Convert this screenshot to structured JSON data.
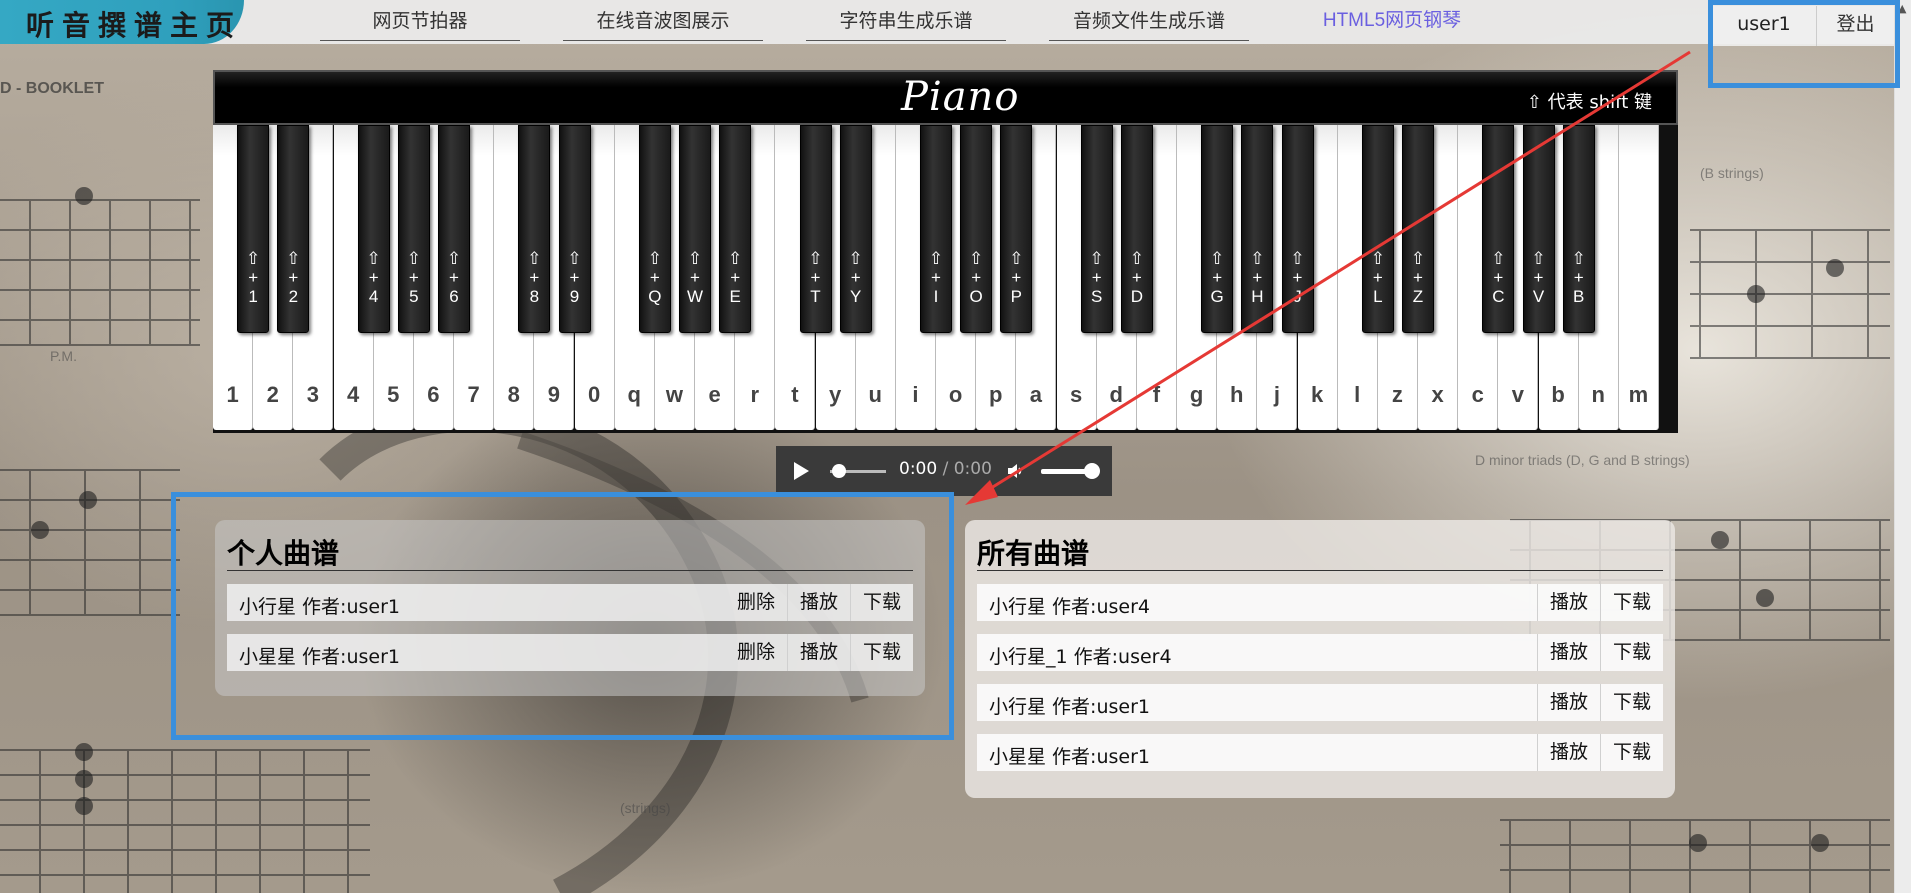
{
  "nav": {
    "logo": "听音撰谱主页",
    "links": [
      "网页节拍器",
      "在线音波图展示",
      "字符串生成乐谱",
      "音频文件生成乐谱",
      "HTML5网页钢琴"
    ],
    "user": "user1",
    "logout": "登出"
  },
  "background": {
    "booklet_text": "D - BOOKLET",
    "label_pm": "P.M.",
    "label_strings": "(strings)",
    "label_b_strings": "(B strings)",
    "label_triads": "D minor triads (D, G and B strings)"
  },
  "piano": {
    "logo": "Piano",
    "shift_note": "⇧ 代表 shift 键",
    "white_keys": [
      "1",
      "2",
      "3",
      "4",
      "5",
      "6",
      "7",
      "8",
      "9",
      "0",
      "q",
      "w",
      "e",
      "r",
      "t",
      "y",
      "u",
      "i",
      "o",
      "p",
      "a",
      "s",
      "d",
      "f",
      "g",
      "h",
      "j",
      "k",
      "l",
      "z",
      "x",
      "c",
      "v",
      "b",
      "n",
      "m"
    ],
    "black_keys": [
      "1",
      "2",
      "4",
      "5",
      "6",
      "8",
      "9",
      "Q",
      "W",
      "E",
      "T",
      "Y",
      "I",
      "O",
      "P",
      "S",
      "D",
      "G",
      "H",
      "J",
      "L",
      "Z",
      "C",
      "V",
      "B"
    ],
    "shift_symbol": "⇧",
    "plus_symbol": "+"
  },
  "player": {
    "current": "0:00",
    "separator": " / ",
    "duration": "0:00"
  },
  "personal": {
    "title": "个人曲谱",
    "rows": [
      {
        "title": "小行星 作者:user1"
      },
      {
        "title": "小星星 作者:user1"
      }
    ],
    "btn_delete": "删除",
    "btn_play": "播放",
    "btn_download": "下载"
  },
  "all": {
    "title": "所有曲谱",
    "rows": [
      {
        "title": "小行星 作者:user4"
      },
      {
        "title": "小行星_1 作者:user4"
      },
      {
        "title": "小行星 作者:user1"
      },
      {
        "title": "小星星 作者:user1"
      }
    ],
    "btn_play": "播放",
    "btn_download": "下载"
  },
  "colors": {
    "annotation": "#3a8fdc",
    "arrow": "#e53935",
    "active_link": "#6a5fe0",
    "logo_bg": "#35a8c4"
  }
}
